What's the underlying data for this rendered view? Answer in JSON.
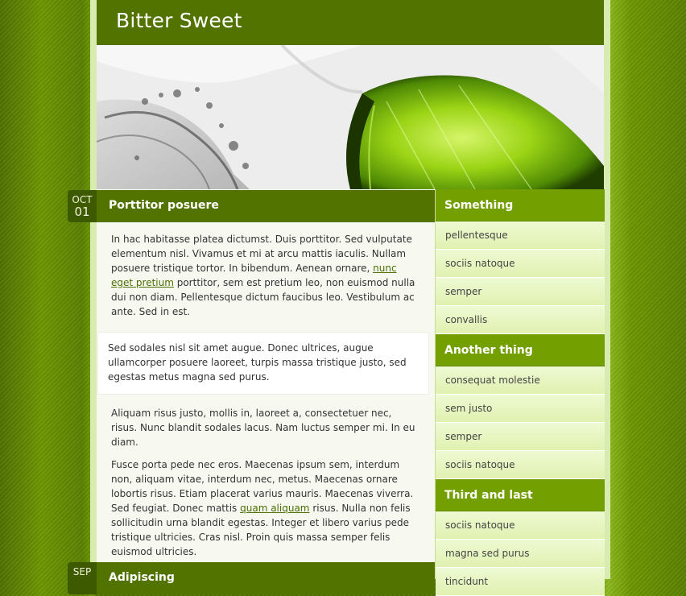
{
  "site": {
    "title": "Bitter Sweet"
  },
  "banner": {
    "alt": "lime slice splashing in water"
  },
  "posts": [
    {
      "month": "OCT",
      "day": "01",
      "title": "Porttitor posuere",
      "p1_a": "In hac habitasse platea dictumst. Duis porttitor. Sed vulputate elementum nisl. Vivamus et mi at arcu mattis iaculis. Nullam posuere tristique tortor. In bibendum. Aenean ornare, ",
      "p1_link": "nunc eget pretium",
      "p1_b": " porttitor, sem est pretium leo, non euismod nulla dui non diam. Pellentesque dictum faucibus leo. Vestibulum ac ante. Sed in est.",
      "quote": "Sed sodales nisl sit amet augue. Donec ultrices, augue ullamcorper posuere laoreet, turpis massa tristique justo, sed egestas metus magna sed purus.",
      "p2": "Aliquam risus justo, mollis in, laoreet a, consectetuer nec, risus. Nunc blandit sodales lacus. Nam luctus semper mi. In eu diam.",
      "p3_a": "Fusce porta pede nec eros. Maecenas ipsum sem, interdum non, aliquam vitae, interdum nec, metus. Maecenas ornare lobortis risus. Etiam placerat varius mauris. Maecenas viverra. Sed feugiat. Donec mattis ",
      "p3_link": "quam aliquam",
      "p3_b": " risus. Nulla non felis sollicitudin urna blandit egestas. Integer et libero varius pede tristique ultricies. Cras nisl. Proin quis massa semper felis euismod ultricies."
    },
    {
      "month": "SEP",
      "title": "Adipiscing"
    }
  ],
  "sidebar": {
    "sections": [
      {
        "title": "Something",
        "items": [
          "pellentesque",
          "sociis natoque",
          "semper",
          "convallis"
        ]
      },
      {
        "title": "Another thing",
        "items": [
          "consequat molestie",
          "sem justo",
          "semper",
          "sociis natoque"
        ]
      },
      {
        "title": "Third and last",
        "items": [
          "sociis natoque",
          "magna sed purus",
          "tincidunt"
        ]
      }
    ]
  },
  "colors": {
    "header": "#527300",
    "accent": "#73a000",
    "link": "#4a6e00",
    "date_bg": "#3d5a00"
  }
}
